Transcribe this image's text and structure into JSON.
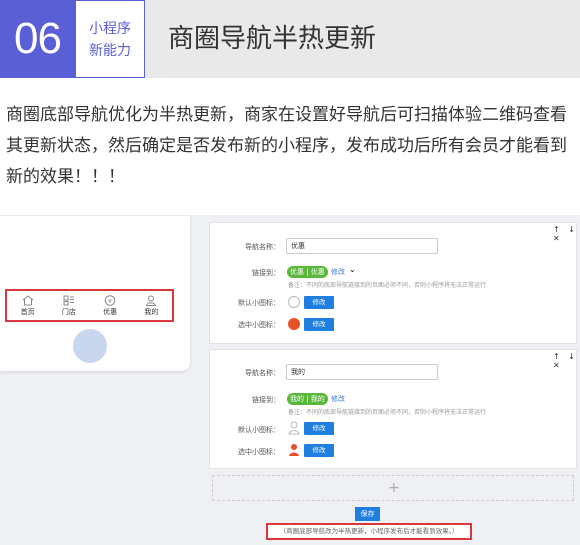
{
  "header": {
    "number": "06",
    "sub_line1": "小程序",
    "sub_line2": "新能力",
    "title": "商圈导航半热更新"
  },
  "intro": "商圈底部导航优化为半热更新，商家在设置好导航后可扫描体验二维码查看其更新状态，然后确定是否发布新的小程序，发布成功后所有会员才能看到新的效果！！！",
  "tabbar": {
    "items": [
      {
        "label": "首页",
        "icon": "home-icon"
      },
      {
        "label": "门店",
        "icon": "store-icon"
      },
      {
        "label": "优惠",
        "icon": "yen-icon"
      },
      {
        "label": "我的",
        "icon": "user-icon"
      }
    ]
  },
  "panel_controls": "↑ ↓ ✕",
  "nav_items": [
    {
      "name_label": "导航名称：",
      "name_value": "优惠",
      "link_label": "链接到：",
      "link_tag": "优惠 | 优惠",
      "link_edit": "修改",
      "link_note": "备注：不同的底部导航链接到的页面必须不同，否则小程序将无法正常运行",
      "default_icon_label": "默认小图标：",
      "selected_icon_label": "选中小图标：",
      "modify": "修改"
    },
    {
      "name_label": "导航名称：",
      "name_value": "我的",
      "link_label": "链接到：",
      "link_tag": "我的 | 我的",
      "link_edit": "修改",
      "link_note": "备注：不同的底部导航链接到的页面必须不同，否则小程序将无法正常运行",
      "default_icon_label": "默认小图标：",
      "selected_icon_label": "选中小图标：",
      "modify": "修改"
    }
  ],
  "add_icon": "+",
  "save_label": "保存",
  "bottom_note": "（商圈底部导航改为半热更新，小程序发布后才能看到效果。）",
  "colors": {
    "accent": "#5b5fd6",
    "highlight_red": "#d9363e",
    "button_blue": "#1e7fe0",
    "tag_green": "#59b73a"
  }
}
